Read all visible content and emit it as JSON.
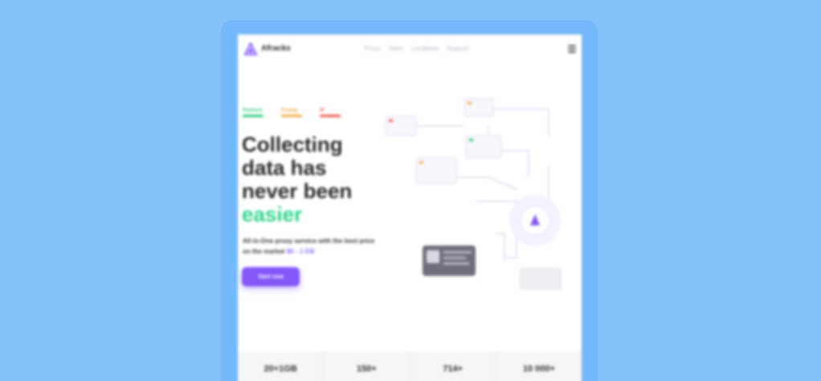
{
  "app": {
    "brand": "Afracks",
    "nav": [
      "Proxy",
      "Stats",
      "Locations",
      "Support"
    ]
  },
  "hero": {
    "badges": [
      {
        "label": "Protocol",
        "color": "#27c97a"
      },
      {
        "label": "Pricing",
        "color": "#f3a73b"
      },
      {
        "label": "IP",
        "color": "#f2564d"
      }
    ],
    "headline_lines": [
      "Collecting",
      "data has",
      "never been"
    ],
    "headline_accent": "easier",
    "subtitle": "All-in-One proxy service with the best price on the market",
    "subtitle_price": "$0 - 1 GB",
    "cta_label": "Start now"
  },
  "stats": [
    "20+1GB",
    "150+",
    "714+",
    "10 000+"
  ],
  "colors": {
    "page_bg": "#86c3fa",
    "device_frame": "#74b8fb",
    "accent_purple": "#8457f7",
    "accent_green": "#2fd58a"
  }
}
